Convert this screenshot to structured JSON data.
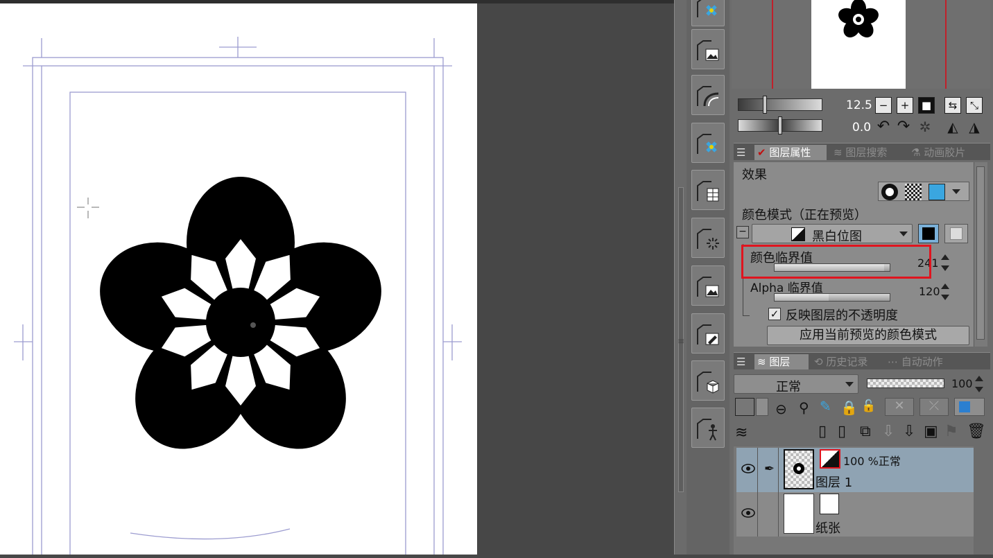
{
  "navigator": {
    "zoom": "12.5",
    "rotation": "0.0"
  },
  "property_panel": {
    "tabs": [
      "图层属性",
      "图层搜索",
      "动画胶片"
    ],
    "effect_label": "效果",
    "color_mode_label": "颜色模式（正在预览）",
    "color_mode_value": "黑白位图",
    "color_threshold_label": "颜色临界值",
    "color_threshold_value": "241",
    "color_threshold_fraction": 0.95,
    "alpha_threshold_label": "Alpha 临界值",
    "alpha_threshold_value": "120",
    "alpha_threshold_fraction": 0.47,
    "reflect_opacity_label": "反映图层的不透明度",
    "reflect_opacity_checked": true,
    "apply_button_label": "应用当前预览的颜色模式"
  },
  "layer_panel": {
    "tabs": [
      "图层",
      "历史记录",
      "自动动作"
    ],
    "blend_mode": "正常",
    "opacity": "100",
    "layers": [
      {
        "info": "100 %正常",
        "name": "图层 1",
        "selected": true
      },
      {
        "info": "",
        "name": "纸张",
        "selected": false
      }
    ]
  },
  "colors": {
    "highlight_box": "#e0141e",
    "selected_layer": "#8fa3b3",
    "panel_bg": "#8b8b8b"
  },
  "icons": [
    "zoom-in-icon",
    "zoom-out-icon",
    "rotate-left-icon",
    "rotate-right-icon",
    "eye-icon",
    "trash-icon"
  ]
}
